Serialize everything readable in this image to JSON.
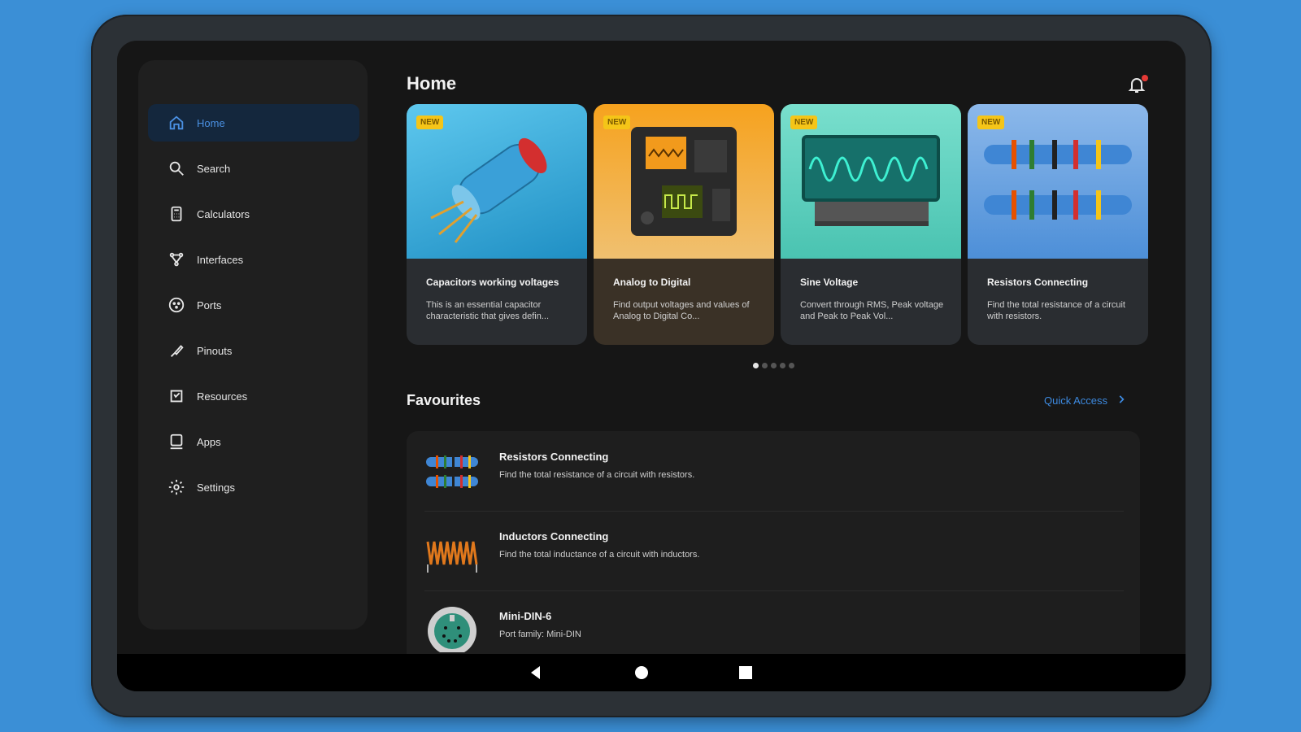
{
  "app": {
    "title": "Home"
  },
  "sidebar": {
    "items": [
      {
        "label": "Home",
        "icon": "home-icon",
        "active": true
      },
      {
        "label": "Search",
        "icon": "search-icon"
      },
      {
        "label": "Calculators",
        "icon": "calculator-icon"
      },
      {
        "label": "Interfaces",
        "icon": "interfaces-icon"
      },
      {
        "label": "Ports",
        "icon": "port-icon"
      },
      {
        "label": "Pinouts",
        "icon": "pinout-icon"
      },
      {
        "label": "Resources",
        "icon": "resources-icon"
      },
      {
        "label": "Apps",
        "icon": "apps-icon"
      },
      {
        "label": "Settings",
        "icon": "gear-icon"
      }
    ]
  },
  "featured": [
    {
      "badge": "NEW",
      "title": "Capacitors working voltages",
      "desc": "This is an essential capacitor characteristic that gives defin...",
      "color": "#2fa6d9"
    },
    {
      "badge": "NEW",
      "title": "Analog to Digital",
      "desc": "Find output voltages and values of Analog to Digital Co...",
      "color": "#f29a1c"
    },
    {
      "badge": "NEW",
      "title": "Sine Voltage",
      "desc": "Convert through RMS, Peak voltage and Peak to Peak Vol...",
      "color": "#5fd0c0"
    },
    {
      "badge": "NEW",
      "title": "Resistors Connecting",
      "desc": "Find the total resistance of a circuit with resistors.",
      "color": "#4d8fd8"
    }
  ],
  "carousel": {
    "pages": 5,
    "current": 1
  },
  "favourites": {
    "title": "Favourites",
    "quick_access": "Quick Access",
    "items": [
      {
        "title": "Resistors Connecting",
        "desc": "Find the total resistance of a circuit with resistors.",
        "icon": "resistor-icon"
      },
      {
        "title": "Inductors Connecting",
        "desc": "Find the total inductance of a circuit with inductors.",
        "icon": "inductor-icon"
      },
      {
        "title": "Mini-DIN-6",
        "desc": "Port family: Mini-DIN",
        "icon": "mini-din-icon"
      }
    ]
  },
  "colors": {
    "accent": "#3d8ae0",
    "background": "#3b8fd6",
    "badge": "#f5c518"
  }
}
